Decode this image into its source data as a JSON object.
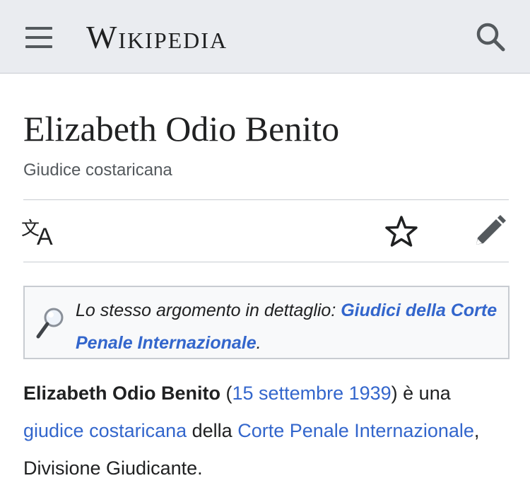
{
  "header": {
    "wordmark": "Wikipedia",
    "menu_icon": "hamburger-menu-icon",
    "search_icon": "search-icon"
  },
  "article": {
    "title": "Elizabeth Odio Benito",
    "subtitle": "Giudice costaricana"
  },
  "actions": {
    "language_icon": "language-icon",
    "watch_icon": "star-icon",
    "edit_icon": "pencil-icon"
  },
  "hatnote": {
    "icon": "magnifier-icon",
    "prefix": "Lo stesso argomento in dettaglio: ",
    "link": "Giudici della Corte Penale Internazionale",
    "suffix": "."
  },
  "intro": {
    "bold_name": "Elizabeth Odio Benito",
    "open_paren": " (",
    "date_link": "15 settembre 1939",
    "after_date": ") è una ",
    "link_role": "giudice costaricana",
    "text_della": " della ",
    "link_court": "Corte Penale Internazionale",
    "tail": ", Divisione Giudicante."
  },
  "colors": {
    "link": "#3366cc",
    "header_bg": "#eaecf0",
    "text": "#202122",
    "muted": "#54595d"
  }
}
